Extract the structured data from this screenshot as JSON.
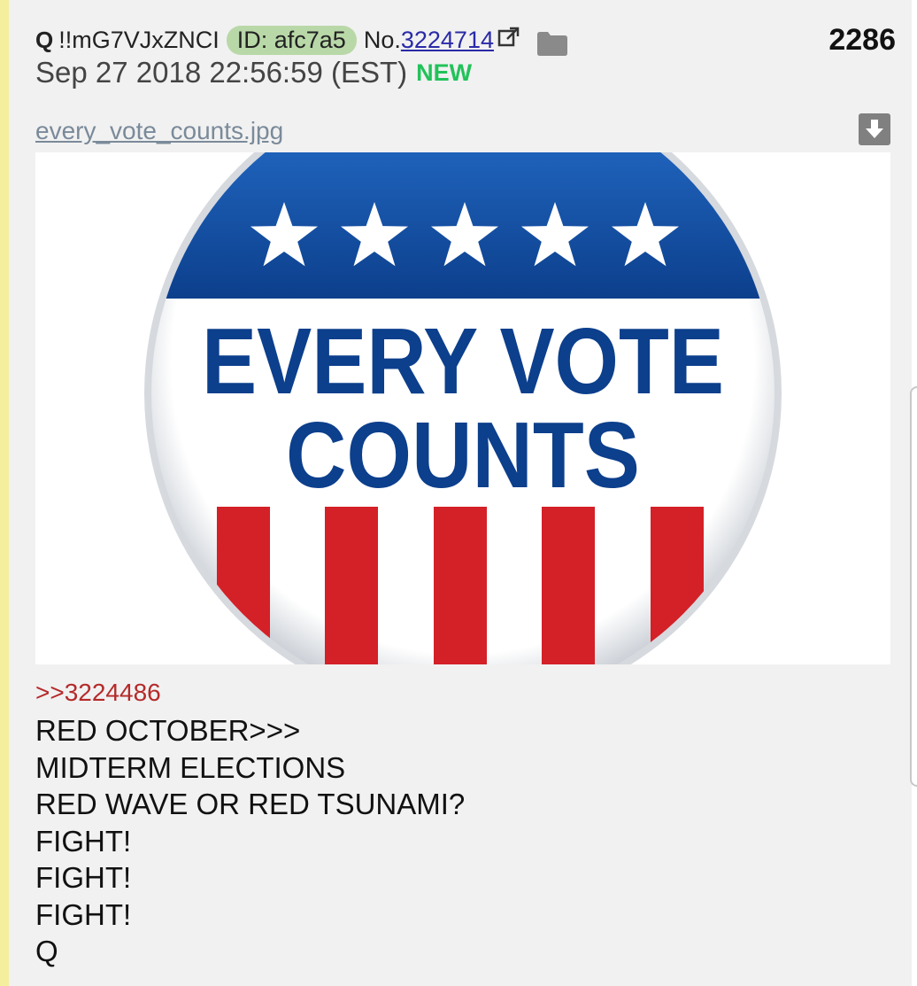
{
  "post": {
    "poster_name": "Q",
    "tripcode": "!!mG7VJxZNCI",
    "id_label": "ID: afc7a5",
    "post_no_label": "No.",
    "post_no": "3224714",
    "reply_count": "2286",
    "timestamp": "Sep 27 2018 22:56:59 (EST)",
    "new_badge": "NEW"
  },
  "file": {
    "name": "every_vote_counts.jpg",
    "image_text_line1": "EVERY VOTE",
    "image_text_line2": "COUNTS",
    "image_colors": {
      "blue": "#0c3f8c",
      "red": "#d42027",
      "white": "#ffffff"
    }
  },
  "body": {
    "quote_link": ">>3224486",
    "lines": [
      "RED OCTOBER>>>",
      "MIDTERM ELECTIONS",
      "RED WAVE OR RED TSUNAMI?",
      "FIGHT!",
      "FIGHT!",
      "FIGHT!",
      "Q"
    ]
  },
  "icons": {
    "external_link": "external-link-icon",
    "folder": "folder-icon",
    "download": "download-icon",
    "star": "star-icon"
  },
  "colors": {
    "post_background": "#f1f1f1",
    "left_accent": "#f3ef9c",
    "id_badge_bg": "#b9d8a8",
    "new_badge": "#22c25a",
    "quote_link": "#b52a2a",
    "post_no_link": "#2a2aa8"
  }
}
